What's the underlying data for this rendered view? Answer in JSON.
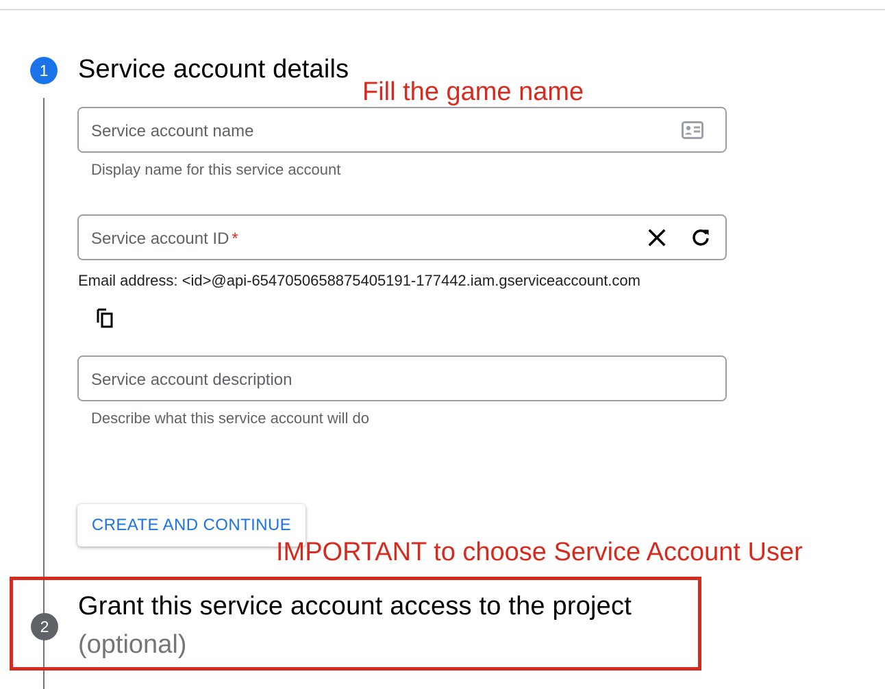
{
  "step1": {
    "number": "1",
    "title": "Service account details"
  },
  "fields": {
    "name": {
      "label": "Service account name",
      "helper": "Display name for this service account",
      "icon": "contact-card-icon"
    },
    "id": {
      "label": "Service account ID",
      "required_marker": "*",
      "clear_icon": "close-icon",
      "refresh_icon": "refresh-icon"
    },
    "email": "Email address: <id>@api-6547050658875405191-177442.iam.gserviceaccount.com",
    "copy_icon": "copy-icon",
    "description": {
      "label": "Service account description",
      "helper": "Describe what this service account will do"
    }
  },
  "create_button": {
    "label": "CREATE AND CONTINUE"
  },
  "step2": {
    "number": "2",
    "title": "Grant this service account access to the project",
    "optional": "(optional)"
  },
  "annotations": {
    "fill_name": "Fill the game name",
    "important": "IMPORTANT to choose Service Account User",
    "color": "#d52b1e"
  },
  "colors": {
    "accent": "#1a73e8",
    "step_inactive": "#5f6368",
    "required": "#d93025"
  }
}
